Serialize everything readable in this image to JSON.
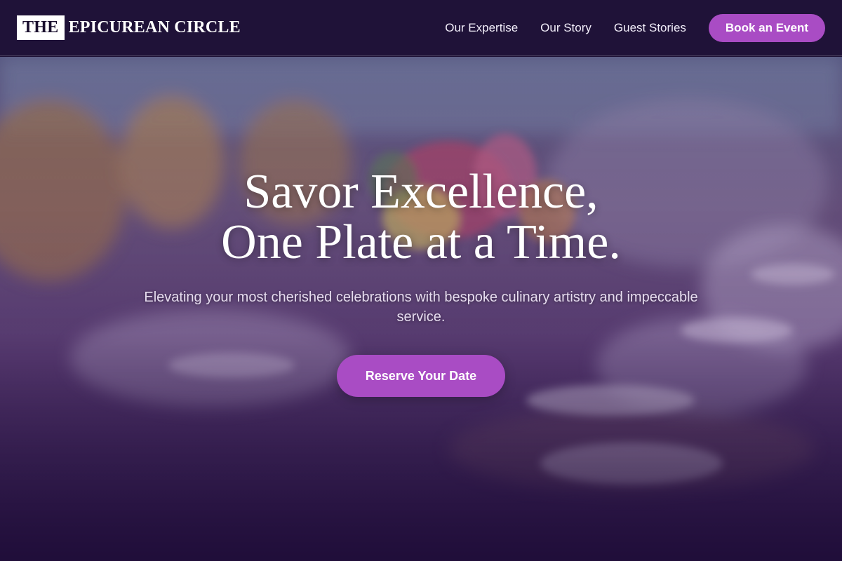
{
  "brand": {
    "boxed": "THE",
    "rest": "EPICUREAN CIRCLE"
  },
  "nav": {
    "links": [
      {
        "label": "Our Expertise"
      },
      {
        "label": "Our Story"
      },
      {
        "label": "Guest Stories"
      }
    ],
    "cta_label": "Book an Event"
  },
  "hero": {
    "title_line1": "Savor Excellence,",
    "title_line2": "One Plate at a Time.",
    "subtitle": "Elevating your most cherished celebrations with bespoke culinary artistry and impeccable service.",
    "cta_label": "Reserve Your Date",
    "background_icon": "banquet-table-photo"
  },
  "colors": {
    "nav_bg": "#1f1238",
    "accent": "#a94cc4",
    "hero_text": "#ffffff"
  }
}
